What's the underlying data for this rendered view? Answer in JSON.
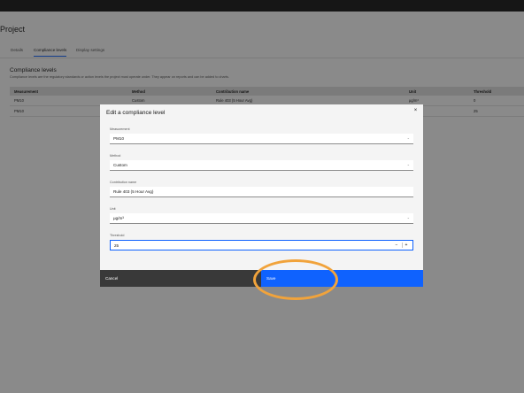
{
  "page": {
    "title": "Project",
    "tabs": [
      {
        "label": "Details"
      },
      {
        "label": "Compliance levels"
      },
      {
        "label": "Display settings"
      }
    ],
    "section_title": "Compliance levels",
    "section_description": "Compliance levels are the regulatory standards or action levels the project must operate under. They appear on reports and can be added to charts."
  },
  "table": {
    "headers": {
      "measurement": "Measurement",
      "method": "Method",
      "contribution": "Contribution name",
      "unit": "Unit",
      "threshold": "Threshold"
    },
    "rows": [
      {
        "measurement": "PM10",
        "method": "Custom",
        "contribution": "Rule 403 (5 Hour Avg)",
        "unit": "µg/m³",
        "threshold": "0"
      },
      {
        "measurement": "PM10",
        "method": "",
        "contribution": "",
        "unit": "",
        "threshold": "25"
      }
    ]
  },
  "modal": {
    "title": "Edit a compliance level",
    "close_icon": "×",
    "fields": {
      "measurement": {
        "label": "Measurement",
        "value": "PM10"
      },
      "method": {
        "label": "Method",
        "value": "Custom"
      },
      "contribution": {
        "label": "Contribution name",
        "value": "Rule 403 (5 Hour Avg)"
      },
      "unit": {
        "label": "Unit",
        "value": "µg/m³"
      },
      "threshold": {
        "label": "Threshold",
        "value": "25",
        "minus": "−",
        "plus": "+"
      }
    },
    "cancel_label": "Cancel",
    "save_label": "Save"
  },
  "colors": {
    "accent": "#0f62fe",
    "highlight": "#f1a33b"
  }
}
